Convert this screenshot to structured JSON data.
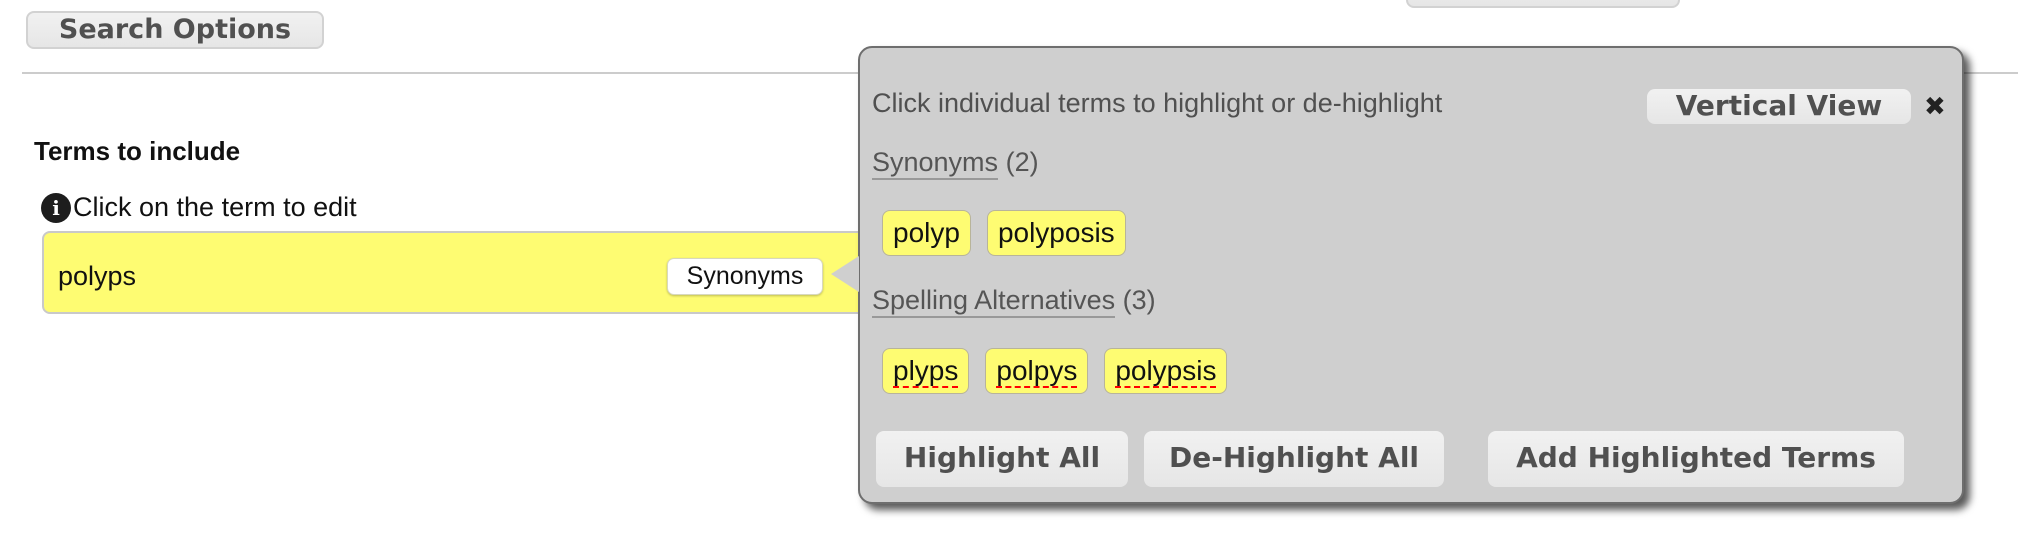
{
  "header": {
    "search_options_label": "Search Options"
  },
  "terms": {
    "heading": "Terms to include",
    "hint": "Click on the term to edit",
    "hint_icon": "info-icon",
    "current_term": "polyps",
    "synonyms_button_label": "Synonyms"
  },
  "popup": {
    "instruction": "Click individual terms to highlight or de-highlight",
    "vertical_view_label": "Vertical View",
    "close_icon": "close-icon",
    "synonyms": {
      "title": "Synonyms",
      "count": "(2)",
      "items": [
        "polyp",
        "polyposis"
      ]
    },
    "spelling": {
      "title": "Spelling Alternatives",
      "count": "(3)",
      "items": [
        "plyps",
        "polpys",
        "polypsis"
      ]
    },
    "buttons": {
      "highlight_all": "Highlight All",
      "dehighlight_all": "De-Highlight All",
      "add_highlighted": "Add Highlighted Terms"
    }
  },
  "colors": {
    "highlight_yellow": "#fefc72",
    "popup_bg": "#cfcfcf",
    "button_text": "#505050"
  }
}
